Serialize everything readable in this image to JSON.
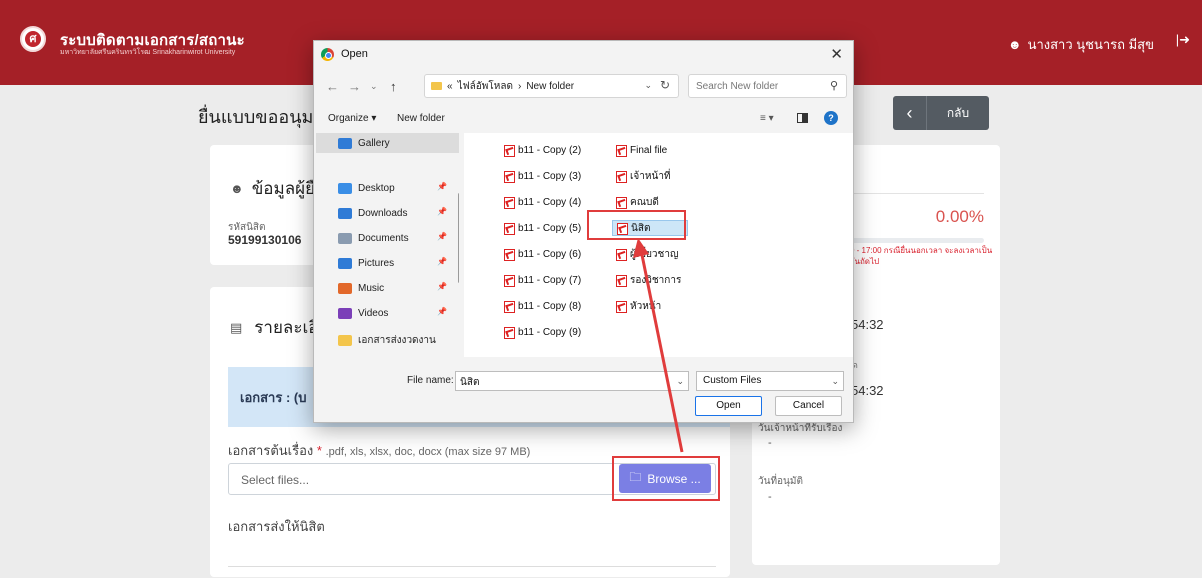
{
  "header": {
    "app_title": "ระบบติดตามเอกสาร/สถานะ",
    "app_subtitle": "มหาวิทยาลัยศรีนครินทรวิโรฒ Srinakharinwirot University",
    "user_name": "นางสาว นุชนารถ มีสุข",
    "logout_icon": "logout-icon",
    "colors": {
      "brand": "#a52027"
    }
  },
  "page": {
    "heading": "ยื่นแบบขออนุม",
    "back_label": "กลับ"
  },
  "student_card": {
    "title": "ข้อมูลผู้ยื",
    "id_label": "รหัสนิสิต",
    "id_value": "59199130106"
  },
  "details_card": {
    "title": "รายละเอีย",
    "doc_band": "เอกสาร : (บ",
    "attach_label": "เอกสารต้นเรื่อง",
    "attach_required": "*",
    "attach_hint": ".pdf, xls, xlsx, doc, docx (max size 97 MB)",
    "file_placeholder": "Select files...",
    "browse_label": "Browse ...",
    "sendback_label": "เอกสารส่งให้นิสิต"
  },
  "status_card": {
    "top_text": "ถ",
    "percent": "0.00%",
    "progress": 0,
    "note": "0 - 17:00 กรณียื่นนอกเวลา จะลงเวลาเป็นวันถัดไป",
    "time1": "54:32",
    "small1": "ด",
    "time2": "54:32",
    "label3": "วันเจ้าหน้าที่รับเรื่อง",
    "value3": "-",
    "label4": "วันที่อนุมัติ",
    "value4": "-"
  },
  "dialog": {
    "title": "Open",
    "address_prefix": "«",
    "address_parent": "ไฟล์อัพโหลด",
    "address_sep": "›",
    "address_current": "New folder",
    "search_placeholder": "Search New folder",
    "organize": "Organize ▾",
    "new_folder": "New folder",
    "sidebar": [
      {
        "label": "Gallery",
        "icon": "gallery-icon",
        "color": "#2f7bd6"
      },
      {
        "label": "Desktop",
        "icon": "desktop-icon",
        "color": "#3a8ee6"
      },
      {
        "label": "Downloads",
        "icon": "download-icon",
        "color": "#2f7bd6"
      },
      {
        "label": "Documents",
        "icon": "documents-icon",
        "color": "#8a9bb0"
      },
      {
        "label": "Pictures",
        "icon": "pictures-icon",
        "color": "#2f7bd6"
      },
      {
        "label": "Music",
        "icon": "music-icon",
        "color": "#e2682a"
      },
      {
        "label": "Videos",
        "icon": "videos-icon",
        "color": "#7b3fb8"
      },
      {
        "label": "เอกสารส่งงวดงาน",
        "icon": "folder-icon",
        "color": "#f3c54b"
      }
    ],
    "files_col1": [
      "b11 - Copy (2)",
      "b11 - Copy (3)",
      "b11 - Copy (4)",
      "b11 - Copy (5)",
      "b11 - Copy (6)",
      "b11 - Copy (7)",
      "b11 - Copy (8)",
      "b11 - Copy (9)"
    ],
    "files_col2": [
      "Final file",
      "เจ้าหน้าที่",
      "คณบดี",
      "นิสิต",
      "ผู้เชี่ยวชาญ",
      "รองวิชาการ",
      "หัวหน้า"
    ],
    "selected_file": "นิสิต",
    "filename_label": "File name:",
    "filename_value": "นิสิต",
    "filetype": "Custom Files",
    "open_label": "Open",
    "cancel_label": "Cancel"
  }
}
